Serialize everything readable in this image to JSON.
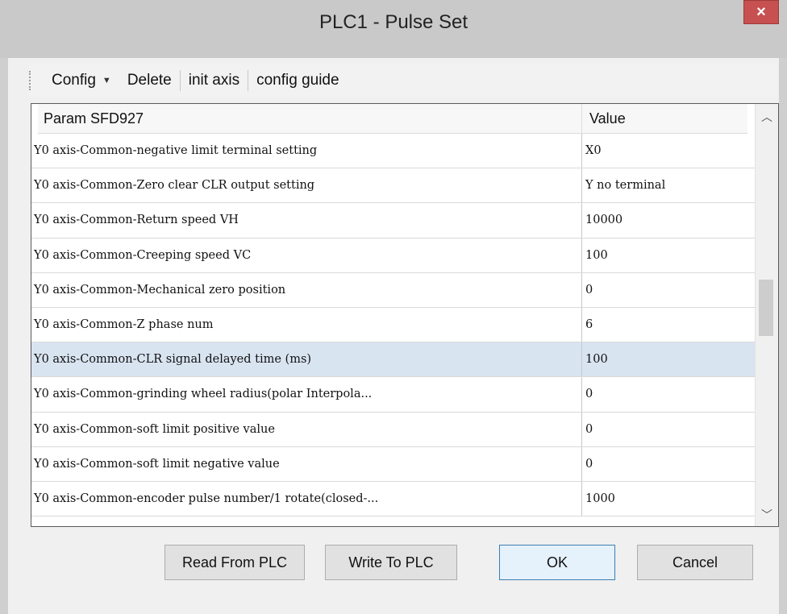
{
  "window": {
    "title": "PLC1 - Pulse  Set",
    "close_symbol": "×"
  },
  "toolbar": {
    "config_label": "Config",
    "delete_label": "Delete",
    "init_axis_label": "init axis",
    "config_guide_label": "config guide"
  },
  "grid": {
    "columns": [
      "Param SFD927",
      "Value"
    ],
    "rows": [
      {
        "param": "Y0 axis-Common-negative limit terminal setting",
        "value": "X0"
      },
      {
        "param": "Y0 axis-Common-Zero clear CLR output setting",
        "value": "Y no terminal"
      },
      {
        "param": "Y0 axis-Common-Return speed VH",
        "value": "10000"
      },
      {
        "param": "Y0 axis-Common-Creeping speed VC",
        "value": "100"
      },
      {
        "param": "Y0 axis-Common-Mechanical zero position",
        "value": "0"
      },
      {
        "param": "Y0 axis-Common-Z phase num",
        "value": "6"
      },
      {
        "param": "Y0 axis-Common-CLR signal delayed time (ms)",
        "value": "100"
      },
      {
        "param": "Y0 axis-Common-grinding wheel radius(polar Interpola...",
        "value": "0"
      },
      {
        "param": "Y0 axis-Common-soft limit positive value",
        "value": "0"
      },
      {
        "param": "Y0 axis-Common-soft limit negative value",
        "value": "0"
      },
      {
        "param": "Y0 axis-Common-encoder pulse number/1 rotate(closed-...",
        "value": "1000"
      }
    ],
    "selected_row_index": 6
  },
  "buttons": {
    "read": "Read From PLC",
    "write": "Write To PLC",
    "ok": "OK",
    "cancel": "Cancel"
  },
  "icons": {
    "dropdown": "chevron-down-icon",
    "scroll_up": "chevron-up-icon",
    "scroll_down": "chevron-down-icon"
  }
}
